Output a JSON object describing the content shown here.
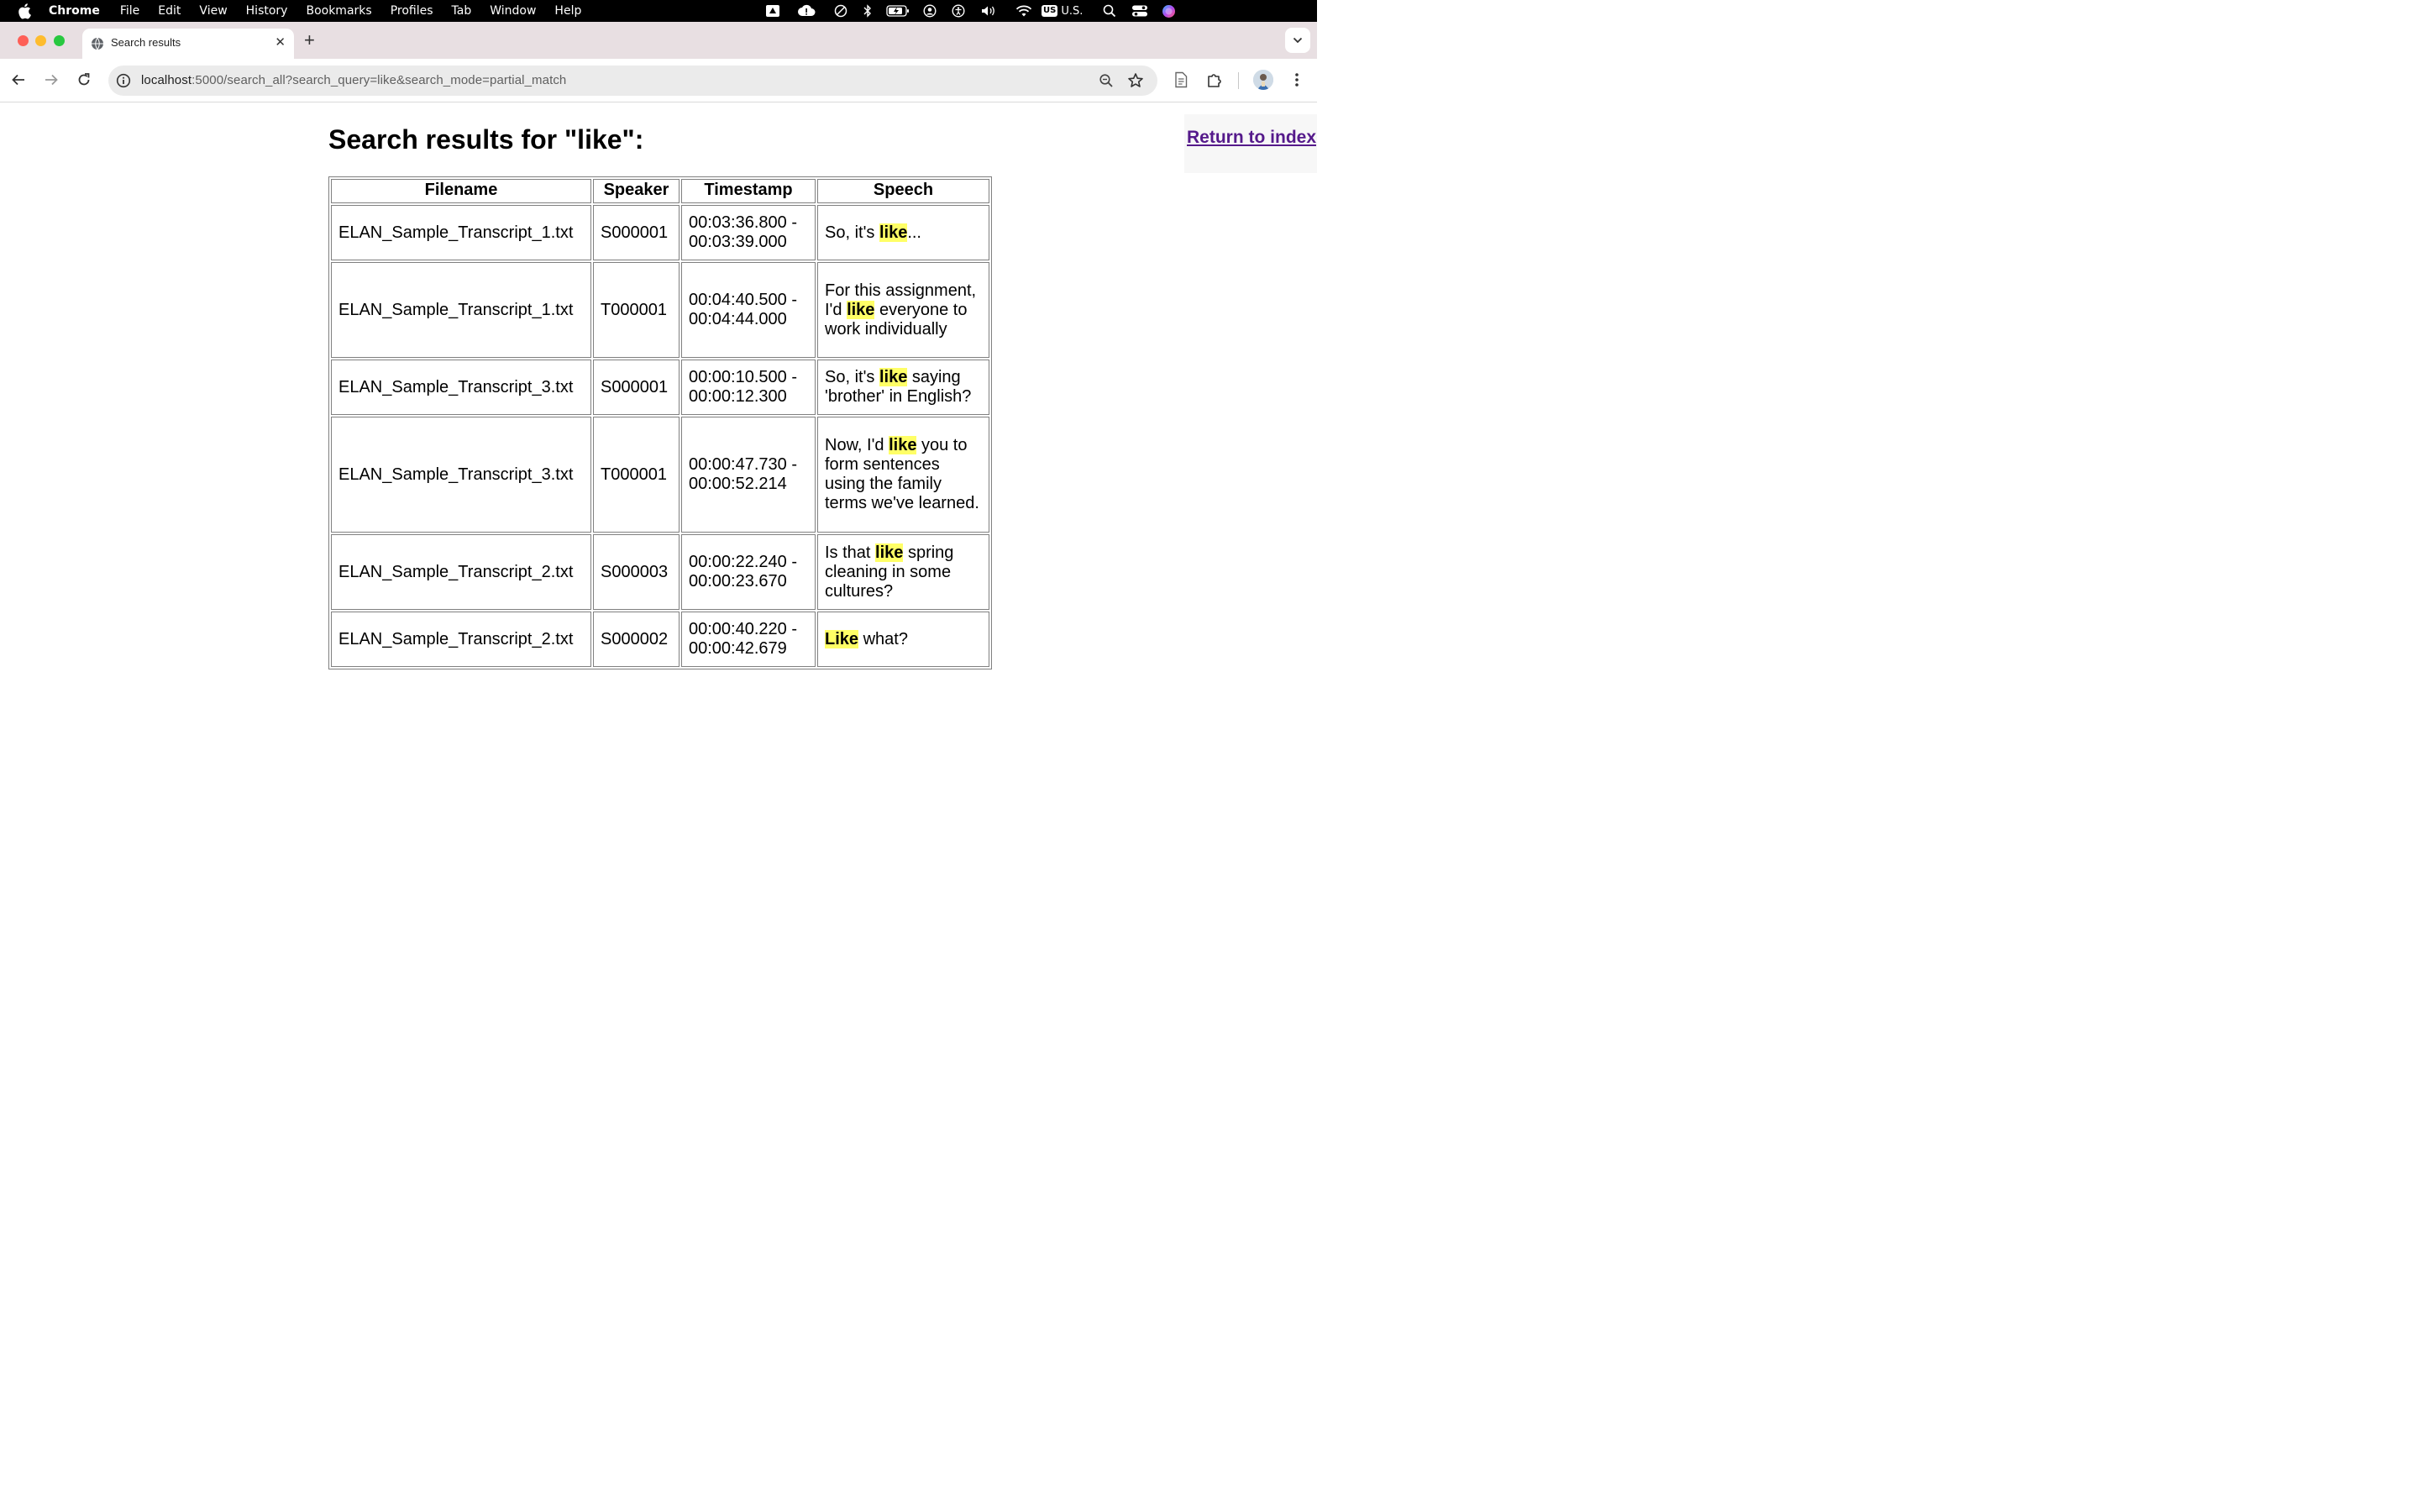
{
  "menubar": {
    "app_name": "Chrome",
    "items": [
      "File",
      "Edit",
      "View",
      "History",
      "Bookmarks",
      "Profiles",
      "Tab",
      "Window",
      "Help"
    ],
    "input_source": "U.S.",
    "input_badge": "US"
  },
  "browser": {
    "tab_title": "Search results",
    "new_tab_symbol": "+",
    "close_symbol": "✕",
    "url_host": "localhost",
    "url_rest": ":5000/search_all?search_query=like&search_mode=partial_match"
  },
  "page": {
    "title": "Search results for \"like\":",
    "return_link": "Return to index",
    "columns": [
      "Filename",
      "Speaker",
      "Timestamp",
      "Speech"
    ],
    "rows": [
      {
        "filename": "ELAN_Sample_Transcript_1.txt",
        "speaker": "S000001",
        "ts_start": "00:03:36.800 -",
        "ts_end": "00:03:39.000",
        "speech_before": "So, it's ",
        "speech_match": "like",
        "speech_after": "..."
      },
      {
        "filename": "ELAN_Sample_Transcript_1.txt",
        "speaker": "T000001",
        "ts_start": "00:04:40.500 -",
        "ts_end": "00:04:44.000",
        "speech_before": "For this assignment, I'd ",
        "speech_match": "like",
        "speech_after": " everyone to work individually"
      },
      {
        "filename": "ELAN_Sample_Transcript_3.txt",
        "speaker": "S000001",
        "ts_start": "00:00:10.500 -",
        "ts_end": "00:00:12.300",
        "speech_before": "So, it's ",
        "speech_match": "like",
        "speech_after": " saying 'brother' in English?"
      },
      {
        "filename": "ELAN_Sample_Transcript_3.txt",
        "speaker": "T000001",
        "ts_start": "00:00:47.730 -",
        "ts_end": "00:00:52.214",
        "speech_before": "Now, I'd ",
        "speech_match": "like",
        "speech_after": " you to form sentences using the family terms we've learned."
      },
      {
        "filename": "ELAN_Sample_Transcript_2.txt",
        "speaker": "S000003",
        "ts_start": "00:00:22.240 -",
        "ts_end": "00:00:23.670",
        "speech_before": "Is that ",
        "speech_match": "like",
        "speech_after": " spring cleaning in some cultures?"
      },
      {
        "filename": "ELAN_Sample_Transcript_2.txt",
        "speaker": "S000002",
        "ts_start": "00:00:40.220 -",
        "ts_end": "00:00:42.679",
        "speech_before": "",
        "speech_match": "Like",
        "speech_after": " what?"
      }
    ]
  },
  "colors": {
    "highlight": "#ffff66",
    "link_visited": "#551a8b",
    "tabstrip": "#e8dfe2"
  }
}
